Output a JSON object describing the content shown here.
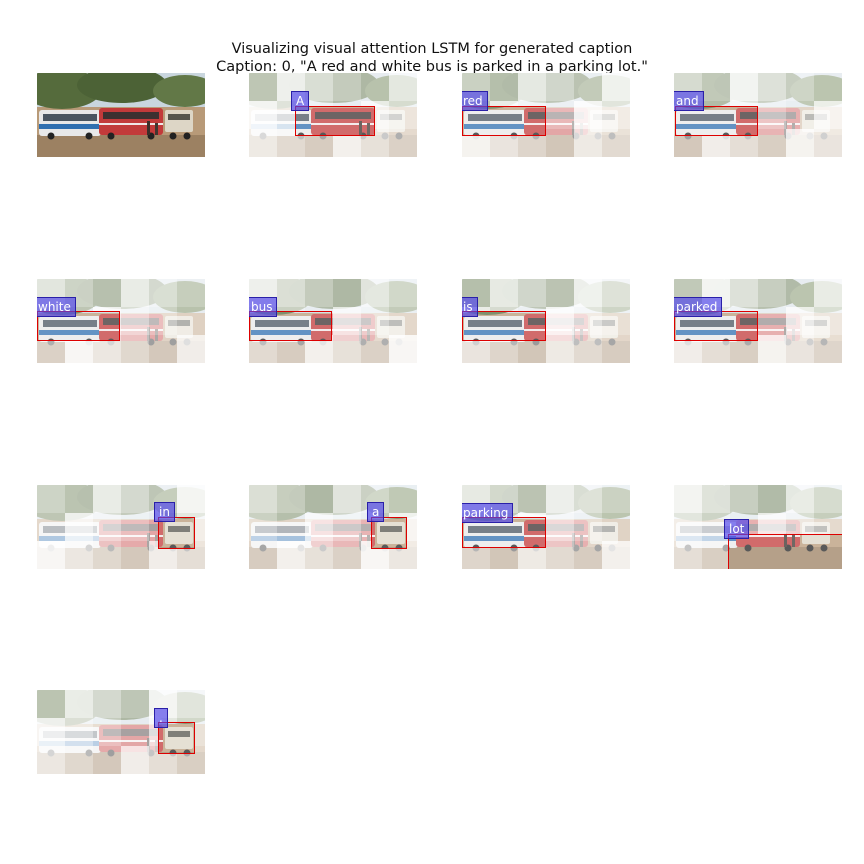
{
  "figure": {
    "title_line_1": "Visualizing visual attention LSTM for generated caption",
    "title_line_2": "Caption: 0, \"A red and white bus is parked in a parking lot.\""
  },
  "palette": {
    "sky": "#c9d6de",
    "trees": "#556b3c",
    "ground": "#b89a78",
    "bus_red": "#c23a3a",
    "bus_white": "#e8e8e8",
    "bus_blue": "#2f6fb0",
    "attention_box": "#dd0000",
    "word_tag": "#5046eb"
  },
  "steps": [
    {
      "word": ""
    },
    {
      "word": "A"
    },
    {
      "word": "red"
    },
    {
      "word": "and"
    },
    {
      "word": "white"
    },
    {
      "word": "bus"
    },
    {
      "word": "is"
    },
    {
      "word": "parked"
    },
    {
      "word": "in"
    },
    {
      "word": "a"
    },
    {
      "word": "parking"
    },
    {
      "word": "lot"
    },
    {
      "word": "."
    }
  ]
}
